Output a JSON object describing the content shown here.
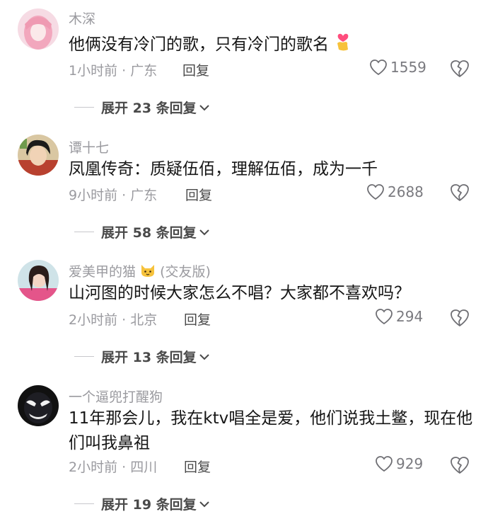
{
  "comments": [
    {
      "username": "木深",
      "text": "他俩没有冷门的歌，只有冷门的歌名",
      "emoji": "finger-heart-emoji",
      "meta": "1小时前 · 广东",
      "reply_label": "回复",
      "likes": "1559",
      "expand_label": "展开 23 条回复"
    },
    {
      "username": "谭十七",
      "text": "凤凰传奇：质疑伍佰，理解伍佰，成为一千",
      "meta": "9小时前 · 广东",
      "reply_label": "回复",
      "likes": "2688",
      "expand_label": "展开 58 条回复"
    },
    {
      "username": "爱美甲的猫",
      "username_suffix": "(交友版)",
      "username_emoji": "cat-face-emoji",
      "text": "山河图的时候大家怎么不唱？大家都不喜欢吗？",
      "meta": "2小时前 · 北京",
      "reply_label": "回复",
      "likes": "294",
      "expand_label": "展开 13 条回复"
    },
    {
      "username": "一个逼兜打醒狗",
      "text": "11年那会儿，我在ktv唱全是爱，他们说我土鳖，现在他们叫我鼻祖",
      "meta": "2小时前 · 四川",
      "reply_label": "回复",
      "likes": "929",
      "expand_label": "展开 19 条回复"
    }
  ],
  "colors": {
    "meta_gray": "#9a9a9f",
    "text_dark": "#161616",
    "action_gray": "#4a4a4a"
  }
}
